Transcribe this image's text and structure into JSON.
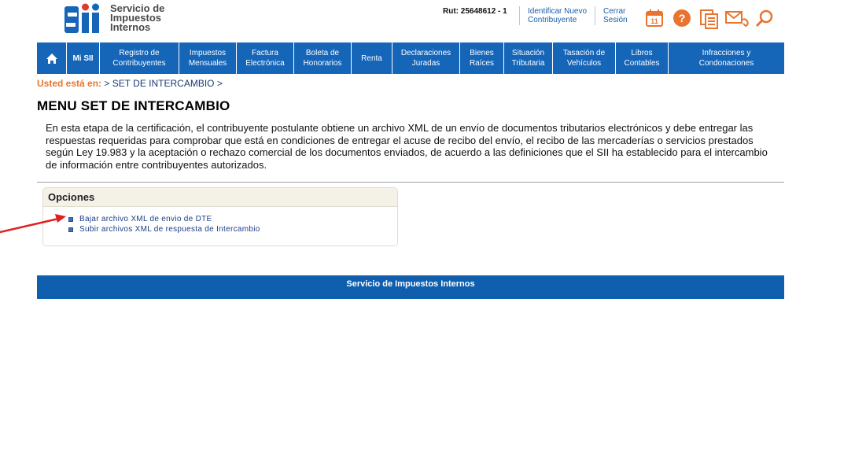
{
  "header": {
    "logo_mark": "SII",
    "logo_lines": [
      "Servicio de",
      "Impuestos",
      "Internos"
    ],
    "rut": "Rut: 25648612 - 1",
    "link_identify": [
      "Identificar Nuevo",
      "Contribuyente"
    ],
    "link_logout": [
      "Cerrar",
      "Sesión"
    ],
    "icons": [
      "calendar-icon",
      "help-icon",
      "documents-icon",
      "contact-icon",
      "search-icon"
    ],
    "calendar_day": "11"
  },
  "nav": [
    {
      "label": ""
    },
    {
      "label": "Mi SII"
    },
    {
      "label": "Registro de\nContribuyentes"
    },
    {
      "label": "Impuestos\nMensuales"
    },
    {
      "label": "Factura\nElectrónica"
    },
    {
      "label": "Boleta de\nHonorarios"
    },
    {
      "label": "Renta"
    },
    {
      "label": "Declaraciones\nJuradas"
    },
    {
      "label": "Bienes\nRaíces"
    },
    {
      "label": "Situación\nTributaria"
    },
    {
      "label": "Tasación de\nVehículos"
    },
    {
      "label": "Libros\nContables"
    },
    {
      "label": "Infracciones y\nCondonaciones"
    }
  ],
  "breadcrumb": {
    "prefix": "Usted está en:",
    "path": "> SET DE INTERCAMBIO >"
  },
  "page_title": "MENU SET DE INTERCAMBIO",
  "intro": "En esta etapa de la certificación, el contribuyente postulante obtiene un archivo XML de un envío de documentos tributarios electrónicos y debe entregar las respuestas requeridas para comprobar que está en condiciones de entregar el acuse de recibo del envío, el recibo de las mercaderías o servicios prestados según Ley 19.983 y la aceptación o rechazo comercial de los documentos enviados, de acuerdo a las definiciones que el SII ha establecido para el intercambio de información entre contribuyentes autorizados.",
  "options": {
    "title": "Opciones",
    "items": [
      "Bajar archivo XML de envio de DTE",
      "Subir archivos XML de respuesta de Intercambio"
    ]
  },
  "footer": "Servicio de Impuestos Internos",
  "colors": {
    "nav": "#1565b8",
    "accent": "#e8742f",
    "link": "#1b3e88"
  }
}
